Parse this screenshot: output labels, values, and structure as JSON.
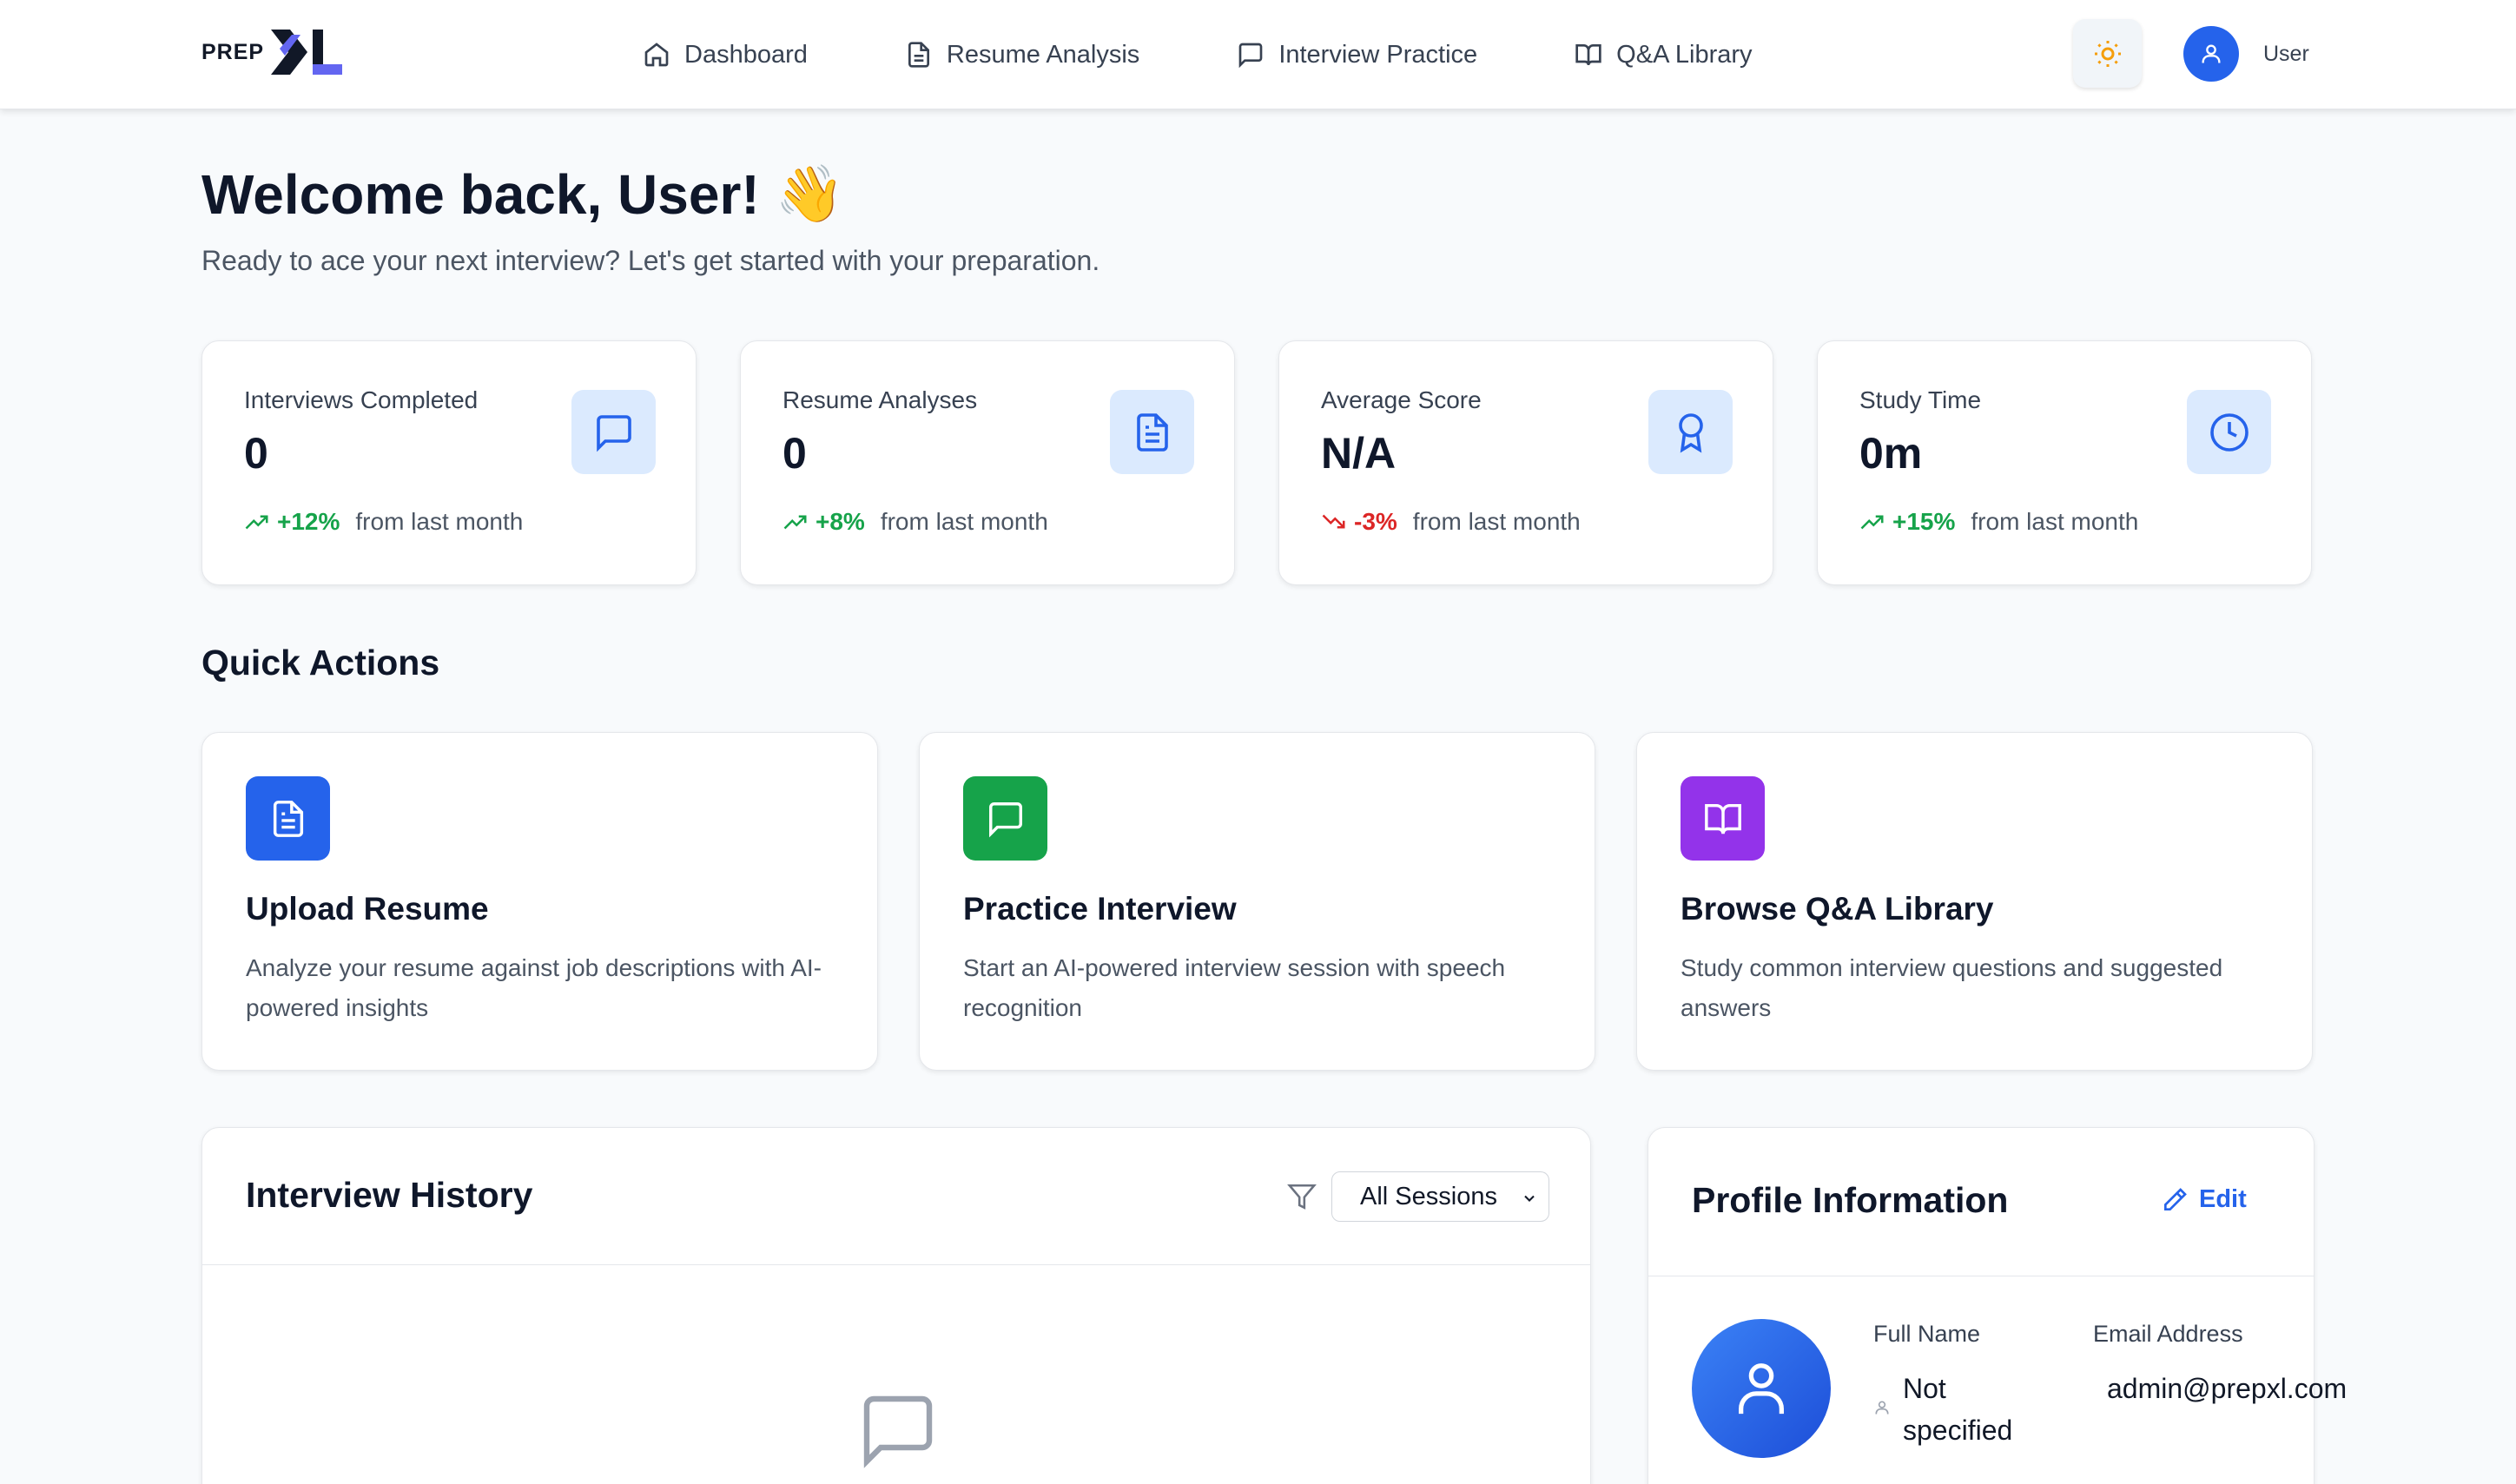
{
  "header": {
    "logo_text": "PREP",
    "logo_mark": "XL",
    "nav": [
      {
        "label": "Dashboard",
        "icon": "home-icon"
      },
      {
        "label": "Resume Analysis",
        "icon": "document-icon"
      },
      {
        "label": "Interview Practice",
        "icon": "message-icon"
      },
      {
        "label": "Q&A Library",
        "icon": "book-icon"
      }
    ],
    "theme_icon": "sun-icon",
    "user_name": "User"
  },
  "welcome": {
    "title": "Welcome back, User!",
    "emoji": "👋",
    "subtitle": "Ready to ace your next interview? Let's get started with your preparation."
  },
  "stats": [
    {
      "label": "Interviews Completed",
      "value": "0",
      "trend": "+12%",
      "trend_dir": "up",
      "trend_text": "from last month",
      "icon": "message-icon"
    },
    {
      "label": "Resume Analyses",
      "value": "0",
      "trend": "+8%",
      "trend_dir": "up",
      "trend_text": "from last month",
      "icon": "document-icon"
    },
    {
      "label": "Average Score",
      "value": "N/A",
      "trend": "-3%",
      "trend_dir": "down",
      "trend_text": "from last month",
      "icon": "award-icon"
    },
    {
      "label": "Study Time",
      "value": "0m",
      "trend": "+15%",
      "trend_dir": "up",
      "trend_text": "from last month",
      "icon": "clock-icon"
    }
  ],
  "quick_actions": {
    "title": "Quick Actions",
    "items": [
      {
        "title": "Upload Resume",
        "desc": "Analyze your resume against job descriptions with AI-powered insights",
        "color": "#2563eb",
        "icon": "document-icon"
      },
      {
        "title": "Practice Interview",
        "desc": "Start an AI-powered interview session with speech recognition",
        "color": "#16a34a",
        "icon": "message-icon"
      },
      {
        "title": "Browse Q&A Library",
        "desc": "Study common interview questions and suggested answers",
        "color": "#9333ea",
        "icon": "book-icon"
      }
    ]
  },
  "history": {
    "title": "Interview History",
    "filter_value": "All Sessions"
  },
  "profile": {
    "title": "Profile Information",
    "edit_label": "Edit",
    "full_name_label": "Full Name",
    "full_name_value": "Not specified",
    "email_label": "Email Address",
    "email_value": "admin@prepxl.com"
  },
  "colors": {
    "accent": "#2563eb",
    "trend_up": "#16a34a",
    "trend_down": "#dc2626",
    "theme_sun": "#f59e0b"
  }
}
